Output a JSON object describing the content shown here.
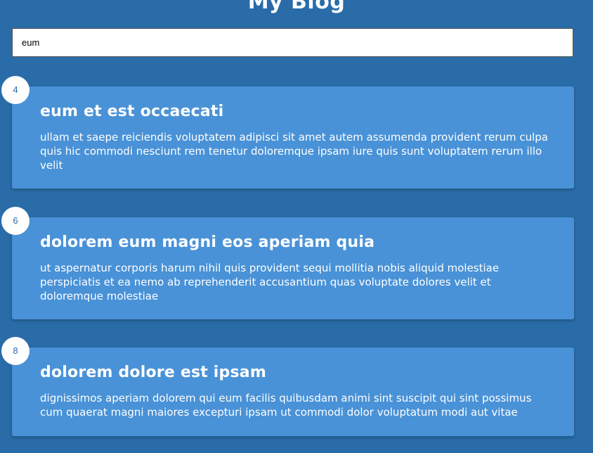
{
  "header": {
    "title": "My Blog"
  },
  "search": {
    "value": "eum"
  },
  "posts": [
    {
      "number": "4",
      "title": "eum et est occaecati",
      "body": "ullam et saepe reiciendis voluptatem adipisci sit amet autem assumenda provident rerum culpa quis hic commodi nesciunt rem tenetur doloremque ipsam iure quis sunt voluptatem rerum illo velit"
    },
    {
      "number": "6",
      "title": "dolorem eum magni eos aperiam quia",
      "body": "ut aspernatur corporis harum nihil quis provident sequi mollitia nobis aliquid molestiae perspiciatis et ea nemo ab reprehenderit accusantium quas voluptate dolores velit et doloremque molestiae"
    },
    {
      "number": "8",
      "title": "dolorem dolore est ipsam",
      "body": "dignissimos aperiam dolorem qui eum facilis quibusdam animi sint suscipit qui sint possimus cum quaerat magni maiores excepturi ipsam ut commodi dolor voluptatum modi aut vitae"
    }
  ],
  "colors": {
    "background": "#296ca8",
    "card": "#4992d7",
    "text": "#ffffff",
    "badge_bg": "#ffffff",
    "badge_text": "#296ca8"
  }
}
